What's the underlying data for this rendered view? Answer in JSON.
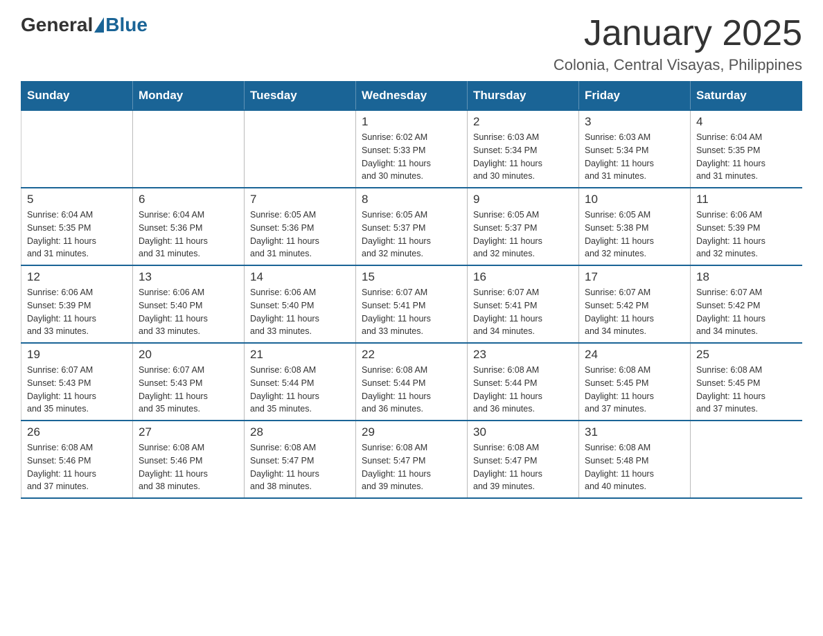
{
  "header": {
    "logo": {
      "general": "General",
      "blue": "Blue"
    },
    "title": "January 2025",
    "subtitle": "Colonia, Central Visayas, Philippines"
  },
  "calendar": {
    "days_of_week": [
      "Sunday",
      "Monday",
      "Tuesday",
      "Wednesday",
      "Thursday",
      "Friday",
      "Saturday"
    ],
    "weeks": [
      [
        {
          "day": "",
          "info": ""
        },
        {
          "day": "",
          "info": ""
        },
        {
          "day": "",
          "info": ""
        },
        {
          "day": "1",
          "info": "Sunrise: 6:02 AM\nSunset: 5:33 PM\nDaylight: 11 hours\nand 30 minutes."
        },
        {
          "day": "2",
          "info": "Sunrise: 6:03 AM\nSunset: 5:34 PM\nDaylight: 11 hours\nand 30 minutes."
        },
        {
          "day": "3",
          "info": "Sunrise: 6:03 AM\nSunset: 5:34 PM\nDaylight: 11 hours\nand 31 minutes."
        },
        {
          "day": "4",
          "info": "Sunrise: 6:04 AM\nSunset: 5:35 PM\nDaylight: 11 hours\nand 31 minutes."
        }
      ],
      [
        {
          "day": "5",
          "info": "Sunrise: 6:04 AM\nSunset: 5:35 PM\nDaylight: 11 hours\nand 31 minutes."
        },
        {
          "day": "6",
          "info": "Sunrise: 6:04 AM\nSunset: 5:36 PM\nDaylight: 11 hours\nand 31 minutes."
        },
        {
          "day": "7",
          "info": "Sunrise: 6:05 AM\nSunset: 5:36 PM\nDaylight: 11 hours\nand 31 minutes."
        },
        {
          "day": "8",
          "info": "Sunrise: 6:05 AM\nSunset: 5:37 PM\nDaylight: 11 hours\nand 32 minutes."
        },
        {
          "day": "9",
          "info": "Sunrise: 6:05 AM\nSunset: 5:37 PM\nDaylight: 11 hours\nand 32 minutes."
        },
        {
          "day": "10",
          "info": "Sunrise: 6:05 AM\nSunset: 5:38 PM\nDaylight: 11 hours\nand 32 minutes."
        },
        {
          "day": "11",
          "info": "Sunrise: 6:06 AM\nSunset: 5:39 PM\nDaylight: 11 hours\nand 32 minutes."
        }
      ],
      [
        {
          "day": "12",
          "info": "Sunrise: 6:06 AM\nSunset: 5:39 PM\nDaylight: 11 hours\nand 33 minutes."
        },
        {
          "day": "13",
          "info": "Sunrise: 6:06 AM\nSunset: 5:40 PM\nDaylight: 11 hours\nand 33 minutes."
        },
        {
          "day": "14",
          "info": "Sunrise: 6:06 AM\nSunset: 5:40 PM\nDaylight: 11 hours\nand 33 minutes."
        },
        {
          "day": "15",
          "info": "Sunrise: 6:07 AM\nSunset: 5:41 PM\nDaylight: 11 hours\nand 33 minutes."
        },
        {
          "day": "16",
          "info": "Sunrise: 6:07 AM\nSunset: 5:41 PM\nDaylight: 11 hours\nand 34 minutes."
        },
        {
          "day": "17",
          "info": "Sunrise: 6:07 AM\nSunset: 5:42 PM\nDaylight: 11 hours\nand 34 minutes."
        },
        {
          "day": "18",
          "info": "Sunrise: 6:07 AM\nSunset: 5:42 PM\nDaylight: 11 hours\nand 34 minutes."
        }
      ],
      [
        {
          "day": "19",
          "info": "Sunrise: 6:07 AM\nSunset: 5:43 PM\nDaylight: 11 hours\nand 35 minutes."
        },
        {
          "day": "20",
          "info": "Sunrise: 6:07 AM\nSunset: 5:43 PM\nDaylight: 11 hours\nand 35 minutes."
        },
        {
          "day": "21",
          "info": "Sunrise: 6:08 AM\nSunset: 5:44 PM\nDaylight: 11 hours\nand 35 minutes."
        },
        {
          "day": "22",
          "info": "Sunrise: 6:08 AM\nSunset: 5:44 PM\nDaylight: 11 hours\nand 36 minutes."
        },
        {
          "day": "23",
          "info": "Sunrise: 6:08 AM\nSunset: 5:44 PM\nDaylight: 11 hours\nand 36 minutes."
        },
        {
          "day": "24",
          "info": "Sunrise: 6:08 AM\nSunset: 5:45 PM\nDaylight: 11 hours\nand 37 minutes."
        },
        {
          "day": "25",
          "info": "Sunrise: 6:08 AM\nSunset: 5:45 PM\nDaylight: 11 hours\nand 37 minutes."
        }
      ],
      [
        {
          "day": "26",
          "info": "Sunrise: 6:08 AM\nSunset: 5:46 PM\nDaylight: 11 hours\nand 37 minutes."
        },
        {
          "day": "27",
          "info": "Sunrise: 6:08 AM\nSunset: 5:46 PM\nDaylight: 11 hours\nand 38 minutes."
        },
        {
          "day": "28",
          "info": "Sunrise: 6:08 AM\nSunset: 5:47 PM\nDaylight: 11 hours\nand 38 minutes."
        },
        {
          "day": "29",
          "info": "Sunrise: 6:08 AM\nSunset: 5:47 PM\nDaylight: 11 hours\nand 39 minutes."
        },
        {
          "day": "30",
          "info": "Sunrise: 6:08 AM\nSunset: 5:47 PM\nDaylight: 11 hours\nand 39 minutes."
        },
        {
          "day": "31",
          "info": "Sunrise: 6:08 AM\nSunset: 5:48 PM\nDaylight: 11 hours\nand 40 minutes."
        },
        {
          "day": "",
          "info": ""
        }
      ]
    ]
  }
}
